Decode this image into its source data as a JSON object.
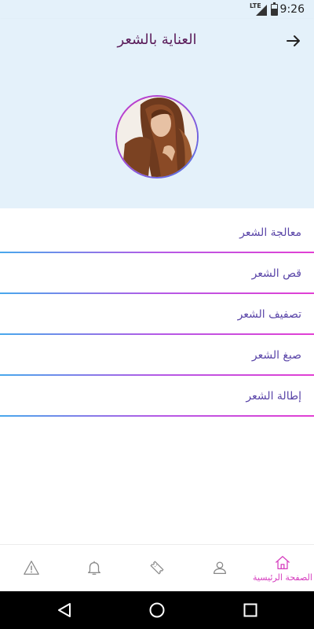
{
  "status_bar": {
    "time": "9:26",
    "network": "LTE"
  },
  "app_bar": {
    "title": "العناية بالشعر",
    "back_icon": "arrow-right-icon"
  },
  "profile": {
    "image": "woman-long-brown-hair-avatar"
  },
  "menu": {
    "items": [
      {
        "label": "معالجة الشعر"
      },
      {
        "label": "قص الشعر"
      },
      {
        "label": "تصفيف الشعر"
      },
      {
        "label": "صبغ الشعر"
      },
      {
        "label": "إطالة الشعر"
      }
    ]
  },
  "bottom_nav": {
    "items": [
      {
        "icon": "warning-icon",
        "label": ""
      },
      {
        "icon": "bell-icon",
        "label": ""
      },
      {
        "icon": "ticket-icon",
        "label": ""
      },
      {
        "icon": "user-icon",
        "label": ""
      },
      {
        "icon": "home-icon",
        "label": "الصفحة الرئيسية",
        "active": true
      }
    ]
  },
  "colors": {
    "header_bg": "#e4f1fa",
    "title": "#5a1c5a",
    "menu_text": "#5a45a8",
    "active": "#d63fbf",
    "divider_start": "#48a8ec",
    "divider_end": "#e23fd4"
  }
}
